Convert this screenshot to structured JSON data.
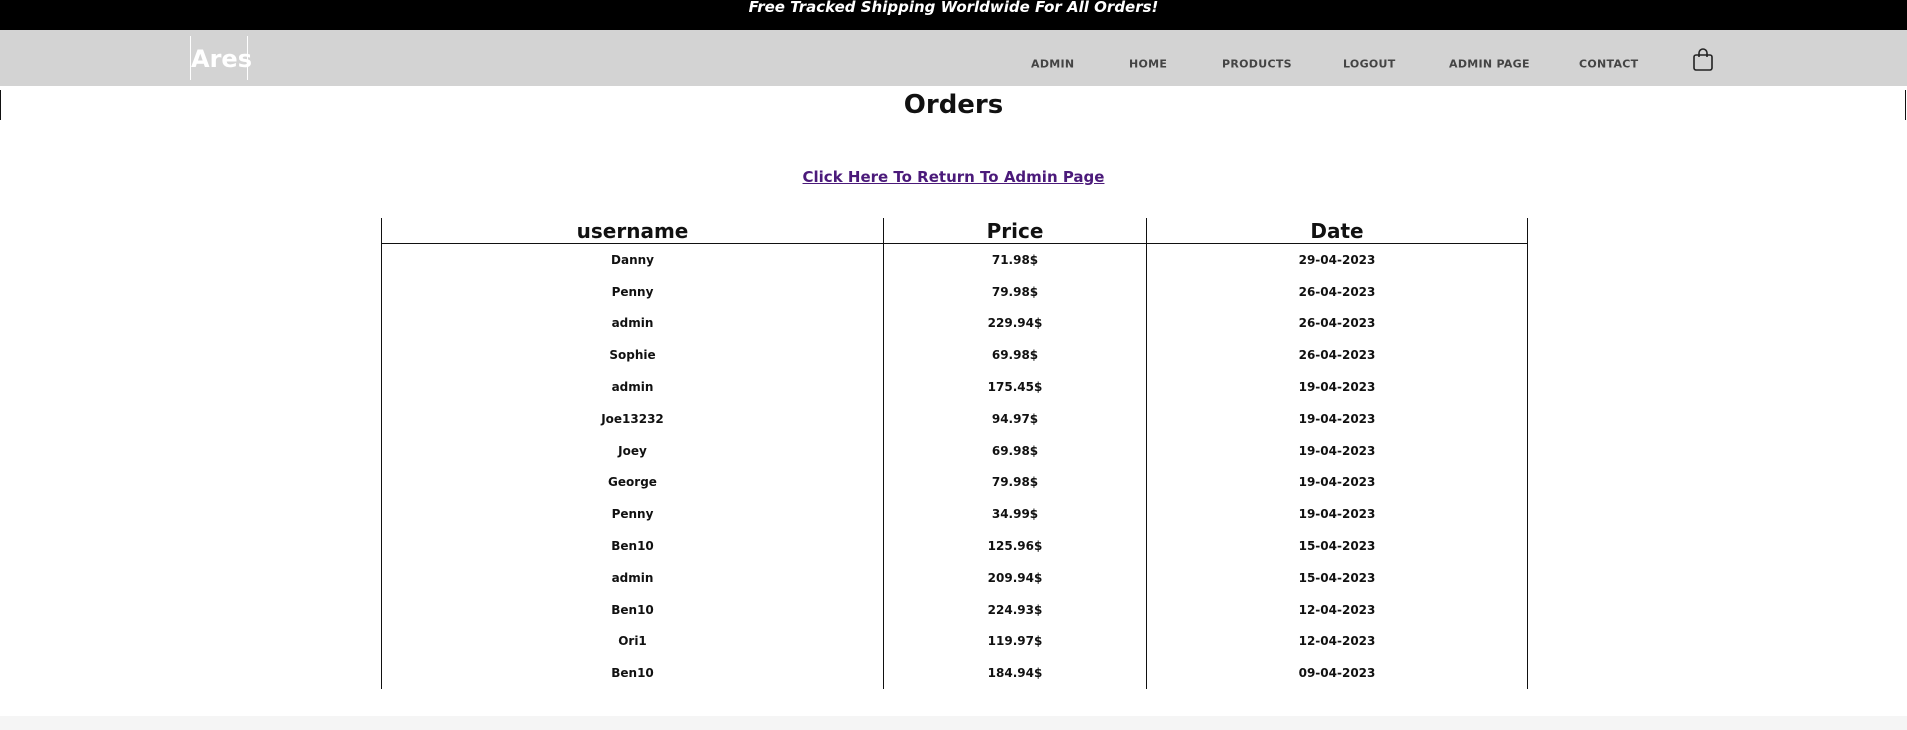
{
  "promo": {
    "text": "Free Tracked Shipping Worldwide For All Orders!"
  },
  "nav": {
    "logo": "Ares",
    "items": [
      {
        "label": "ADMIN"
      },
      {
        "label": "HOME"
      },
      {
        "label": "PRODUCTS"
      },
      {
        "label": "LOGOUT"
      },
      {
        "label": "ADMIN PAGE"
      },
      {
        "label": "CONTACT"
      }
    ],
    "cart_icon": "shopping-bag-icon"
  },
  "page": {
    "title": "Orders",
    "return_link": "Click Here To Return To Admin Page"
  },
  "table": {
    "columns": [
      "username",
      "Price",
      "Date"
    ],
    "rows": [
      {
        "username": "Danny",
        "price": "71.98$",
        "date": "29-04-2023"
      },
      {
        "username": "Penny",
        "price": "79.98$",
        "date": "26-04-2023"
      },
      {
        "username": "admin",
        "price": "229.94$",
        "date": "26-04-2023"
      },
      {
        "username": "Sophie",
        "price": "69.98$",
        "date": "26-04-2023"
      },
      {
        "username": "admin",
        "price": "175.45$",
        "date": "19-04-2023"
      },
      {
        "username": "Joe13232",
        "price": "94.97$",
        "date": "19-04-2023"
      },
      {
        "username": "Joey",
        "price": "69.98$",
        "date": "19-04-2023"
      },
      {
        "username": "George",
        "price": "79.98$",
        "date": "19-04-2023"
      },
      {
        "username": "Penny",
        "price": "34.99$",
        "date": "19-04-2023"
      },
      {
        "username": "Ben10",
        "price": "125.96$",
        "date": "15-04-2023"
      },
      {
        "username": "admin",
        "price": "209.94$",
        "date": "15-04-2023"
      },
      {
        "username": "Ben10",
        "price": "224.93$",
        "date": "12-04-2023"
      },
      {
        "username": "Ori1",
        "price": "119.97$",
        "date": "12-04-2023"
      },
      {
        "username": "Ben10",
        "price": "184.94$",
        "date": "09-04-2023"
      }
    ]
  },
  "colors": {
    "promo_bg": "#000000",
    "nav_bg": "#d3d3d3",
    "link": "#4b1a7a"
  }
}
